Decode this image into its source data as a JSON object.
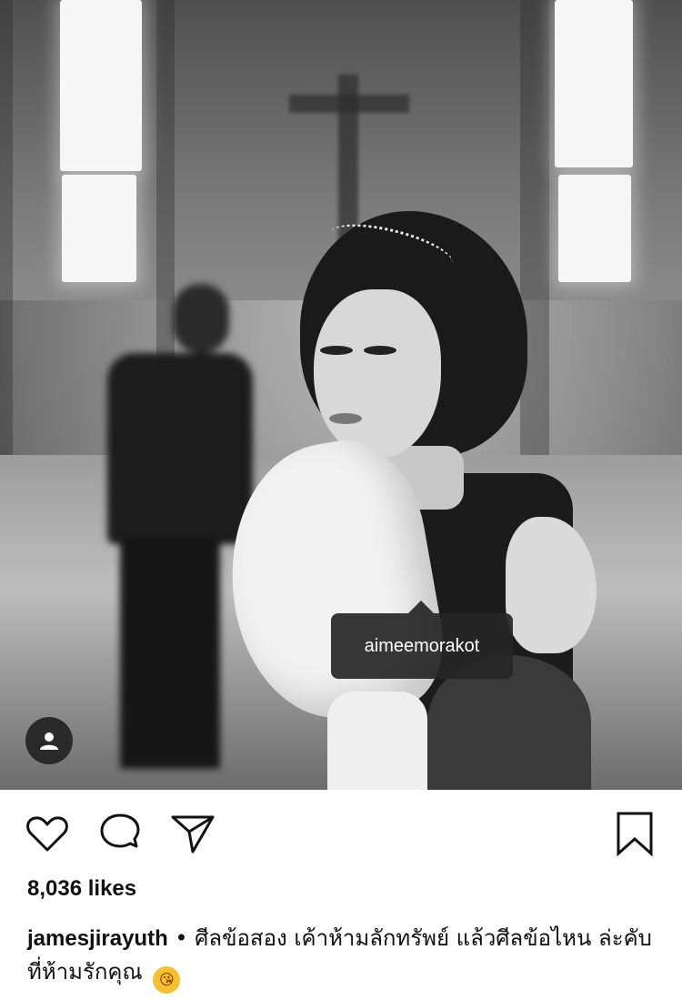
{
  "post": {
    "photo_tag_username": "aimeemorakot",
    "likes_text": "8,036 likes",
    "caption_username": "jamesjirayuth",
    "caption_separator": "•",
    "caption_text": "ศีลข้อสอง เค้าห้ามลักทรัพย์ แล้วศีลข้อไหน ล่ะคับ ที่ห้ามรักคุณ",
    "caption_emoji": "😘"
  },
  "icons": {
    "like": "heart-icon",
    "comment": "comment-icon",
    "share": "send-icon",
    "save": "bookmark-icon",
    "tags": "person-icon"
  },
  "colors": {
    "text": "#111111",
    "background": "#ffffff",
    "tag_bg": "#262626"
  }
}
